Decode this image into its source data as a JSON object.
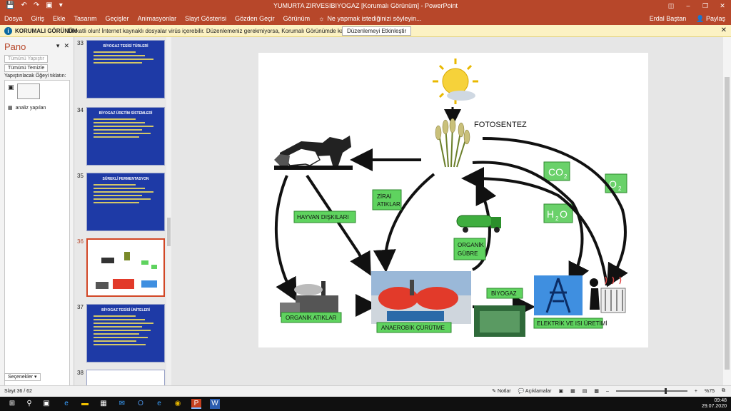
{
  "app": {
    "title": "YUMURTA ZIRVESIBIYOGAZ [Korumalı Görünüm] - PowerPoint",
    "user": "Erdal Baştan",
    "share_label": "Paylaş"
  },
  "ribbon": {
    "tabs": [
      "Dosya",
      "Giriş",
      "Ekle",
      "Tasarım",
      "Geçişler",
      "Animasyonlar",
      "Slayt Gösterisi",
      "Gözden Geçir",
      "Görünüm"
    ],
    "tell_me": "Ne yapmak istediğinizi söyleyin..."
  },
  "protected_view": {
    "title": "KORUMALI GÖRÜNÜM",
    "message": "Dikkatli olun! İnternet kaynaklı dosyalar virüs içerebilir. Düzenlemeniz gerekmiyorsa, Korumalı Görünümde kalmanız daha güvenli olur.",
    "button": "Düzenlemeyi Etkinleştir"
  },
  "clipboard_pane": {
    "title": "Pano",
    "paste_all": "Tümünü Yapıştır",
    "clear_all": "Tümünü Temizle",
    "hint": "Yapıştırılacak Öğeyi tıklatın:",
    "item_label": "analiz yapılan",
    "options": "Seçenekler"
  },
  "thumbnails": [
    {
      "num": "33",
      "title": "BİYOGAZ TESİSİ TÜRLERİ",
      "style": "blue",
      "lines": 4
    },
    {
      "num": "34",
      "title": "BİYOGAZ ÜRETİM SİSTEMLERİ",
      "style": "blue",
      "lines": 6
    },
    {
      "num": "35",
      "title": "SÜREKLİ FERMENTASYON",
      "style": "blue",
      "lines": 6
    },
    {
      "num": "36",
      "title": "",
      "style": "diagram",
      "lines": 0,
      "active": true
    },
    {
      "num": "37",
      "title": "BİYOGAZ TESİSİ ÜNİTELERİ",
      "style": "blue",
      "lines": 9
    },
    {
      "num": "38",
      "title": "",
      "style": "white",
      "lines": 0
    }
  ],
  "slide": {
    "fotosentez": "FOTOSENTEZ",
    "co2": "CO",
    "co2_sub": "2",
    "o2": "O",
    "o2_sub": "2",
    "h2o_h": "H",
    "h2o_sub": "2",
    "h2o_o": "O",
    "zirai_1": "ZİRAİ",
    "zirai_2": "ATIKLAR",
    "hayvan": "HAYVAN DIŞKILARI",
    "organik_gubre_1": "ORGANİK",
    "organik_gubre_2": "GÜBRE",
    "biyogaz": "BİYOGAZ",
    "organik_atiklar": "ORGANİK ATIKLAR",
    "anaerobik": "ANAEROBİK ÇÜRÜTME",
    "elektrik": "ELEKTRİK VE ISI ÜRETİMİ"
  },
  "status_bar": {
    "slide_info": "Slayt 36 / 62",
    "notes": "Notlar",
    "comments": "Açıklamalar",
    "zoom": "%75"
  },
  "taskbar": {
    "time": "09:48",
    "date": "29.07.2020"
  },
  "colors": {
    "accent": "#b7472a",
    "label_green": "#5fd35f",
    "thumb_blue": "#1e3aa6"
  }
}
